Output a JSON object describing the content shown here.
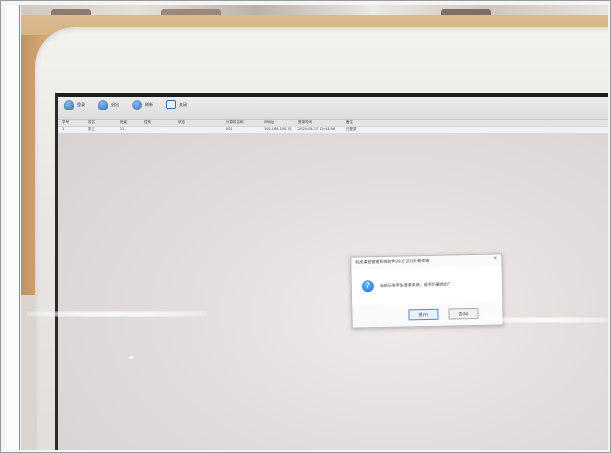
{
  "toolbar": {
    "buttons": [
      {
        "label": "登录",
        "icon": "user-login-icon"
      },
      {
        "label": "退出",
        "icon": "user-logout-icon"
      },
      {
        "label": "刷新",
        "icon": "refresh-icon"
      },
      {
        "label": "关闭",
        "icon": "exit-icon"
      }
    ]
  },
  "table": {
    "headers": [
      "学号",
      "姓名",
      "班级",
      "性别",
      "状态",
      "计算机名称",
      "IP地址",
      "登录时间",
      "备注"
    ],
    "row": [
      "1",
      "张三",
      "21",
      "",
      "",
      "IIS1",
      "192.168.100.11",
      "2024-04-17 10:44:56",
      "已登录"
    ]
  },
  "dialog": {
    "title": "机房课堂管理系统软件V9.0 2016 教师端",
    "close_icon": "close-icon",
    "message": "当前已有学生登录系统，是否仍要退出？",
    "icon": "question-icon",
    "yes_label": "是(Y)",
    "no_label": "否(N)"
  },
  "colors": {
    "bezel": "#ebe9e5",
    "desk": "#c99f6a",
    "screen": "#e2dcdc",
    "accent": "#1f6fd4"
  }
}
